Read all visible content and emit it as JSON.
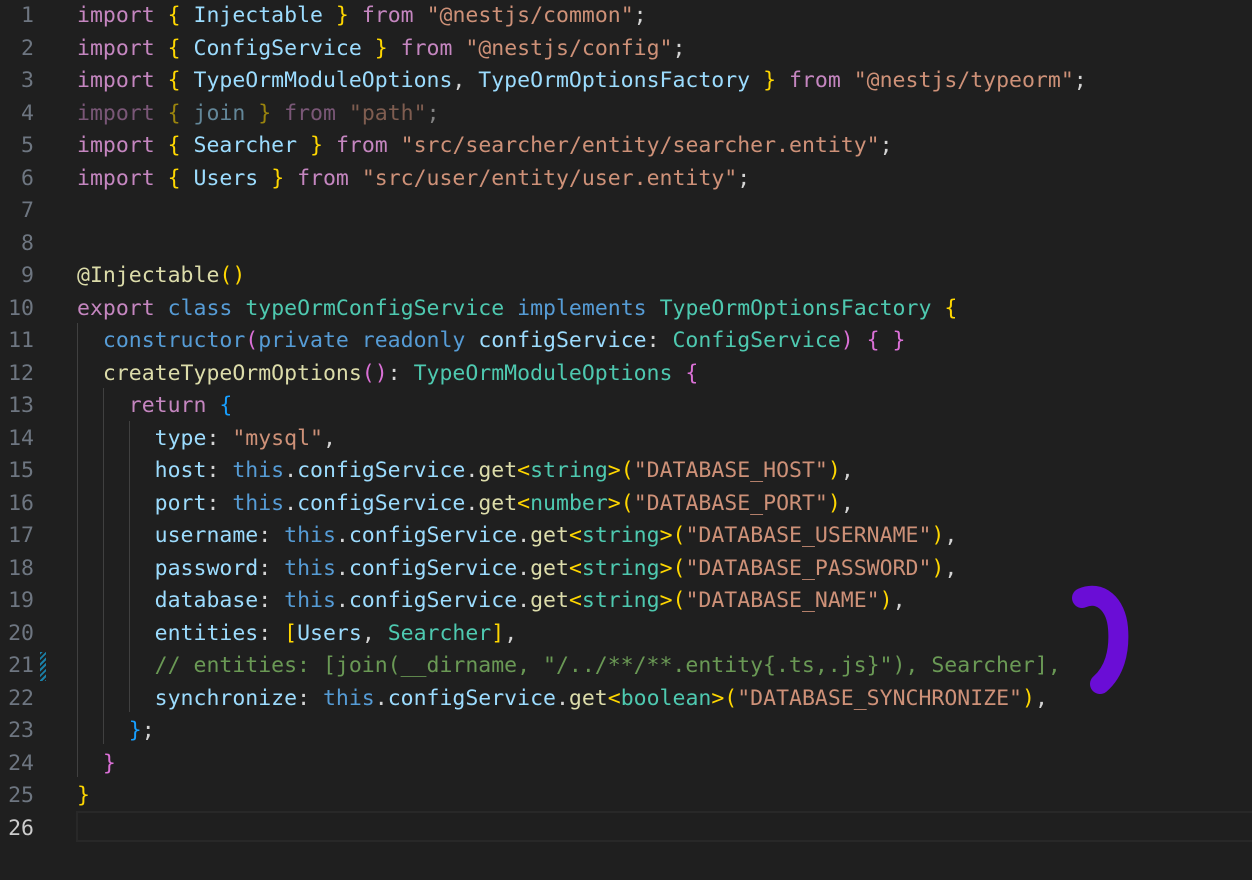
{
  "editor": {
    "language": "typescript",
    "theme_colors": {
      "background": "#1f1f1f",
      "line_number": "#6e7681",
      "line_number_active": "#cccccc",
      "keyword_control": "#c586c0",
      "keyword_storage": "#569cd6",
      "type": "#4ec9b0",
      "identifier": "#9cdcfe",
      "function": "#dcdcaa",
      "string": "#ce9178",
      "comment": "#6a9955",
      "punctuation": "#d4d4d4",
      "bracket_level_1": "#ffd700",
      "bracket_level_2": "#da70d6",
      "bracket_level_3": "#179fff",
      "annotation_stroke": "#6a0dd6"
    },
    "active_line": 26,
    "lines": [
      {
        "num": "1",
        "tokens": [
          [
            "import",
            "kw"
          ],
          [
            " ",
            "p"
          ],
          [
            "{",
            "b1"
          ],
          [
            " Injectable ",
            "id"
          ],
          [
            "}",
            "b1"
          ],
          [
            " ",
            "p"
          ],
          [
            "from",
            "kw"
          ],
          [
            " ",
            "p"
          ],
          [
            "\"@nestjs/common\"",
            "str"
          ],
          [
            ";",
            "p"
          ]
        ]
      },
      {
        "num": "2",
        "tokens": [
          [
            "import",
            "kw"
          ],
          [
            " ",
            "p"
          ],
          [
            "{",
            "b1"
          ],
          [
            " ConfigService ",
            "id"
          ],
          [
            "}",
            "b1"
          ],
          [
            " ",
            "p"
          ],
          [
            "from",
            "kw"
          ],
          [
            " ",
            "p"
          ],
          [
            "\"@nestjs/config\"",
            "str"
          ],
          [
            ";",
            "p"
          ]
        ]
      },
      {
        "num": "3",
        "tokens": [
          [
            "import",
            "kw"
          ],
          [
            " ",
            "p"
          ],
          [
            "{",
            "b1"
          ],
          [
            " TypeOrmModuleOptions",
            "id"
          ],
          [
            ", ",
            "p"
          ],
          [
            "TypeOrmOptionsFactory ",
            "id"
          ],
          [
            "}",
            "b1"
          ],
          [
            " ",
            "p"
          ],
          [
            "from",
            "kw"
          ],
          [
            " ",
            "p"
          ],
          [
            "\"@nestjs/typeorm\"",
            "str"
          ],
          [
            ";",
            "p"
          ]
        ],
        "dim": false
      },
      {
        "num": "4",
        "tokens": [
          [
            "import",
            "kw"
          ],
          [
            " ",
            "p"
          ],
          [
            "{",
            "b1"
          ],
          [
            " join ",
            "id"
          ],
          [
            "}",
            "b1"
          ],
          [
            " ",
            "p"
          ],
          [
            "from",
            "kw"
          ],
          [
            " ",
            "p"
          ],
          [
            "\"path\"",
            "str"
          ],
          [
            ";",
            "p"
          ]
        ],
        "dim": true
      },
      {
        "num": "5",
        "tokens": [
          [
            "import",
            "kw"
          ],
          [
            " ",
            "p"
          ],
          [
            "{",
            "b1"
          ],
          [
            " Searcher ",
            "id"
          ],
          [
            "}",
            "b1"
          ],
          [
            " ",
            "p"
          ],
          [
            "from",
            "kw"
          ],
          [
            " ",
            "p"
          ],
          [
            "\"src/searcher/entity/searcher.entity\"",
            "str"
          ],
          [
            ";",
            "p"
          ]
        ]
      },
      {
        "num": "6",
        "tokens": [
          [
            "import",
            "kw"
          ],
          [
            " ",
            "p"
          ],
          [
            "{",
            "b1"
          ],
          [
            " Users ",
            "id"
          ],
          [
            "}",
            "b1"
          ],
          [
            " ",
            "p"
          ],
          [
            "from",
            "kw"
          ],
          [
            " ",
            "p"
          ],
          [
            "\"src/user/entity/user.entity\"",
            "str"
          ],
          [
            ";",
            "p"
          ]
        ]
      },
      {
        "num": "7",
        "tokens": []
      },
      {
        "num": "8",
        "tokens": []
      },
      {
        "num": "9",
        "tokens": [
          [
            "@Injectable",
            "fn"
          ],
          [
            "()",
            "b1"
          ]
        ]
      },
      {
        "num": "10",
        "tokens": [
          [
            "export",
            "kw"
          ],
          [
            " ",
            "p"
          ],
          [
            "class",
            "st"
          ],
          [
            " ",
            "p"
          ],
          [
            "typeOrmConfigService",
            "ty"
          ],
          [
            " ",
            "p"
          ],
          [
            "implements",
            "st"
          ],
          [
            " ",
            "p"
          ],
          [
            "TypeOrmOptionsFactory",
            "ty"
          ],
          [
            " ",
            "p"
          ],
          [
            "{",
            "b1"
          ]
        ]
      },
      {
        "num": "11",
        "tokens": [
          [
            "  ",
            "p"
          ],
          [
            "constructor",
            "st"
          ],
          [
            "(",
            "b2"
          ],
          [
            "private",
            "st"
          ],
          [
            " ",
            "p"
          ],
          [
            "readonly",
            "st"
          ],
          [
            " ",
            "p"
          ],
          [
            "configService",
            "id"
          ],
          [
            ": ",
            "p"
          ],
          [
            "ConfigService",
            "ty"
          ],
          [
            ")",
            "b2"
          ],
          [
            " ",
            "p"
          ],
          [
            "{ }",
            "b2"
          ]
        ]
      },
      {
        "num": "12",
        "tokens": [
          [
            "  ",
            "p"
          ],
          [
            "createTypeOrmOptions",
            "fn"
          ],
          [
            "()",
            "b2"
          ],
          [
            ": ",
            "p"
          ],
          [
            "TypeOrmModuleOptions",
            "ty"
          ],
          [
            " ",
            "p"
          ],
          [
            "{",
            "b2"
          ]
        ]
      },
      {
        "num": "13",
        "tokens": [
          [
            "    ",
            "p"
          ],
          [
            "return",
            "kw"
          ],
          [
            " ",
            "p"
          ],
          [
            "{",
            "b3"
          ]
        ]
      },
      {
        "num": "14",
        "tokens": [
          [
            "      ",
            "p"
          ],
          [
            "type",
            "id"
          ],
          [
            ": ",
            "p"
          ],
          [
            "\"mysql\"",
            "str"
          ],
          [
            ",",
            "p"
          ]
        ]
      },
      {
        "num": "15",
        "tokens": [
          [
            "      ",
            "p"
          ],
          [
            "host",
            "id"
          ],
          [
            ": ",
            "p"
          ],
          [
            "this",
            "st"
          ],
          [
            ".",
            "p"
          ],
          [
            "configService",
            "id"
          ],
          [
            ".",
            "p"
          ],
          [
            "get",
            "fn"
          ],
          [
            "<",
            "b1"
          ],
          [
            "string",
            "ty"
          ],
          [
            ">",
            "b1"
          ],
          [
            "(",
            "b1"
          ],
          [
            "\"DATABASE_HOST\"",
            "str"
          ],
          [
            ")",
            "b1"
          ],
          [
            ",",
            "p"
          ]
        ]
      },
      {
        "num": "16",
        "tokens": [
          [
            "      ",
            "p"
          ],
          [
            "port",
            "id"
          ],
          [
            ": ",
            "p"
          ],
          [
            "this",
            "st"
          ],
          [
            ".",
            "p"
          ],
          [
            "configService",
            "id"
          ],
          [
            ".",
            "p"
          ],
          [
            "get",
            "fn"
          ],
          [
            "<",
            "b1"
          ],
          [
            "number",
            "ty"
          ],
          [
            ">",
            "b1"
          ],
          [
            "(",
            "b1"
          ],
          [
            "\"DATABASE_PORT\"",
            "str"
          ],
          [
            ")",
            "b1"
          ],
          [
            ",",
            "p"
          ]
        ]
      },
      {
        "num": "17",
        "tokens": [
          [
            "      ",
            "p"
          ],
          [
            "username",
            "id"
          ],
          [
            ": ",
            "p"
          ],
          [
            "this",
            "st"
          ],
          [
            ".",
            "p"
          ],
          [
            "configService",
            "id"
          ],
          [
            ".",
            "p"
          ],
          [
            "get",
            "fn"
          ],
          [
            "<",
            "b1"
          ],
          [
            "string",
            "ty"
          ],
          [
            ">",
            "b1"
          ],
          [
            "(",
            "b1"
          ],
          [
            "\"DATABASE_USERNAME\"",
            "str"
          ],
          [
            ")",
            "b1"
          ],
          [
            ",",
            "p"
          ]
        ]
      },
      {
        "num": "18",
        "tokens": [
          [
            "      ",
            "p"
          ],
          [
            "password",
            "id"
          ],
          [
            ": ",
            "p"
          ],
          [
            "this",
            "st"
          ],
          [
            ".",
            "p"
          ],
          [
            "configService",
            "id"
          ],
          [
            ".",
            "p"
          ],
          [
            "get",
            "fn"
          ],
          [
            "<",
            "b1"
          ],
          [
            "string",
            "ty"
          ],
          [
            ">",
            "b1"
          ],
          [
            "(",
            "b1"
          ],
          [
            "\"DATABASE_PASSWORD\"",
            "str"
          ],
          [
            ")",
            "b1"
          ],
          [
            ",",
            "p"
          ]
        ]
      },
      {
        "num": "19",
        "tokens": [
          [
            "      ",
            "p"
          ],
          [
            "database",
            "id"
          ],
          [
            ": ",
            "p"
          ],
          [
            "this",
            "st"
          ],
          [
            ".",
            "p"
          ],
          [
            "configService",
            "id"
          ],
          [
            ".",
            "p"
          ],
          [
            "get",
            "fn"
          ],
          [
            "<",
            "b1"
          ],
          [
            "string",
            "ty"
          ],
          [
            ">",
            "b1"
          ],
          [
            "(",
            "b1"
          ],
          [
            "\"DATABASE_NAME\"",
            "str"
          ],
          [
            ")",
            "b1"
          ],
          [
            ",",
            "p"
          ]
        ]
      },
      {
        "num": "20",
        "tokens": [
          [
            "      ",
            "p"
          ],
          [
            "entities",
            "id"
          ],
          [
            ": ",
            "p"
          ],
          [
            "[",
            "b1"
          ],
          [
            "Users",
            "id"
          ],
          [
            ", ",
            "p"
          ],
          [
            "Searcher",
            "ty"
          ],
          [
            "]",
            "b1"
          ],
          [
            ",",
            "p"
          ]
        ]
      },
      {
        "num": "21",
        "tokens": [
          [
            "      ",
            "p"
          ],
          [
            "// entities: [join(__dirname, \"/../**/**.entity{.ts,.js}\"), Searcher],",
            "cm"
          ]
        ],
        "gutter_mark": true
      },
      {
        "num": "22",
        "tokens": [
          [
            "      ",
            "p"
          ],
          [
            "synchronize",
            "id"
          ],
          [
            ": ",
            "p"
          ],
          [
            "this",
            "st"
          ],
          [
            ".",
            "p"
          ],
          [
            "configService",
            "id"
          ],
          [
            ".",
            "p"
          ],
          [
            "get",
            "fn"
          ],
          [
            "<",
            "b1"
          ],
          [
            "boolean",
            "ty"
          ],
          [
            ">",
            "b1"
          ],
          [
            "(",
            "b1"
          ],
          [
            "\"DATABASE_SYNCHRONIZE\"",
            "str"
          ],
          [
            ")",
            "b1"
          ],
          [
            ",",
            "p"
          ]
        ]
      },
      {
        "num": "23",
        "tokens": [
          [
            "    ",
            "p"
          ],
          [
            "}",
            "b3"
          ],
          [
            ";",
            "p"
          ]
        ]
      },
      {
        "num": "24",
        "tokens": [
          [
            "  ",
            "p"
          ],
          [
            "}",
            "b2"
          ]
        ]
      },
      {
        "num": "25",
        "tokens": [
          [
            "}",
            "b1"
          ]
        ]
      },
      {
        "num": "26",
        "tokens": []
      }
    ]
  }
}
